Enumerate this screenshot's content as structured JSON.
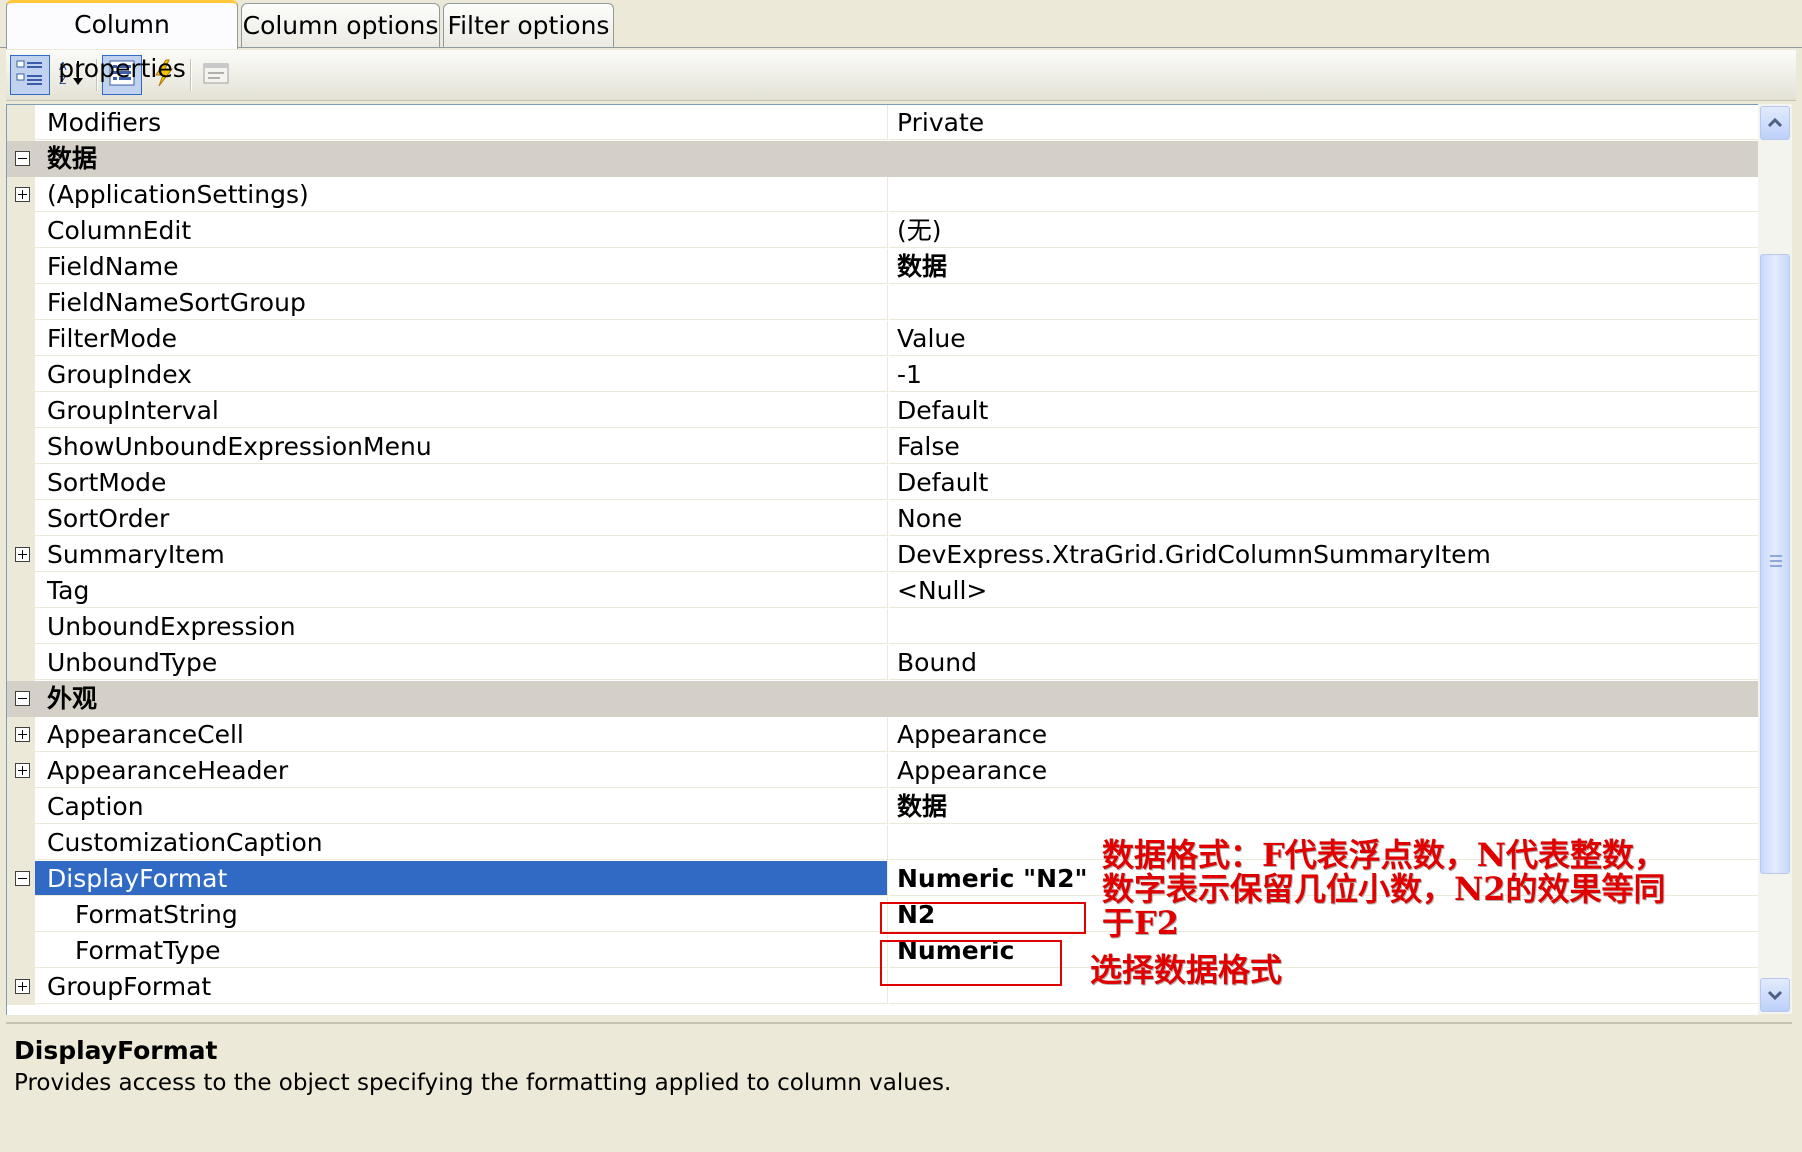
{
  "tabs": [
    {
      "label": "Column properties",
      "active": true
    },
    {
      "label": "Column options",
      "active": false
    },
    {
      "label": "Filter options",
      "active": false
    }
  ],
  "toolbar": {
    "buttons": [
      {
        "icon": "categorized-icon",
        "pressed": true
      },
      {
        "icon": "alphabetical-sort-icon",
        "pressed": false
      },
      {
        "icon": "properties-icon",
        "pressed": true
      },
      {
        "icon": "events-lightning-icon",
        "pressed": false
      },
      {
        "icon": "property-pages-icon",
        "pressed": false
      }
    ]
  },
  "grid": {
    "rows": [
      {
        "name": "Modifiers",
        "value": "Private"
      },
      {
        "category": "数据"
      },
      {
        "name": "(ApplicationSettings)",
        "value": "",
        "expander": "plus"
      },
      {
        "name": "ColumnEdit",
        "value": "(无)"
      },
      {
        "name": "FieldName",
        "value": "数据",
        "bold": true
      },
      {
        "name": "FieldNameSortGroup",
        "value": ""
      },
      {
        "name": "FilterMode",
        "value": "Value"
      },
      {
        "name": "GroupIndex",
        "value": "-1"
      },
      {
        "name": "GroupInterval",
        "value": "Default"
      },
      {
        "name": "ShowUnboundExpressionMenu",
        "value": "False"
      },
      {
        "name": "SortMode",
        "value": "Default"
      },
      {
        "name": "SortOrder",
        "value": "None"
      },
      {
        "name": "SummaryItem",
        "value": "DevExpress.XtraGrid.GridColumnSummaryItem",
        "expander": "plus"
      },
      {
        "name": "Tag",
        "value": "<Null>"
      },
      {
        "name": "UnboundExpression",
        "value": ""
      },
      {
        "name": "UnboundType",
        "value": "Bound"
      },
      {
        "category": "外观"
      },
      {
        "name": "AppearanceCell",
        "value": "Appearance",
        "expander": "plus"
      },
      {
        "name": "AppearanceHeader",
        "value": "Appearance",
        "expander": "plus"
      },
      {
        "name": "Caption",
        "value": "数据",
        "bold": true
      },
      {
        "name": "CustomizationCaption",
        "value": ""
      },
      {
        "name": "DisplayFormat",
        "value": "Numeric \"N2\"",
        "bold": true,
        "selected": true,
        "expander": "minus"
      },
      {
        "name": "FormatString",
        "value": "N2",
        "bold": true,
        "indent": true
      },
      {
        "name": "FormatType",
        "value": "Numeric",
        "bold": true,
        "indent": true
      },
      {
        "name": "GroupFormat",
        "value": "",
        "expander": "plus"
      }
    ]
  },
  "description": {
    "title": "DisplayFormat",
    "text": "Provides access to the object specifying the formatting applied to column values."
  },
  "annotations": {
    "note1_line1": "数据格式：F代表浮点数，N代表整数，",
    "note1_line2": "数字表示保留几位小数，N2的效果等同",
    "note1_line3": "于F2",
    "note2": "选择数据格式"
  }
}
